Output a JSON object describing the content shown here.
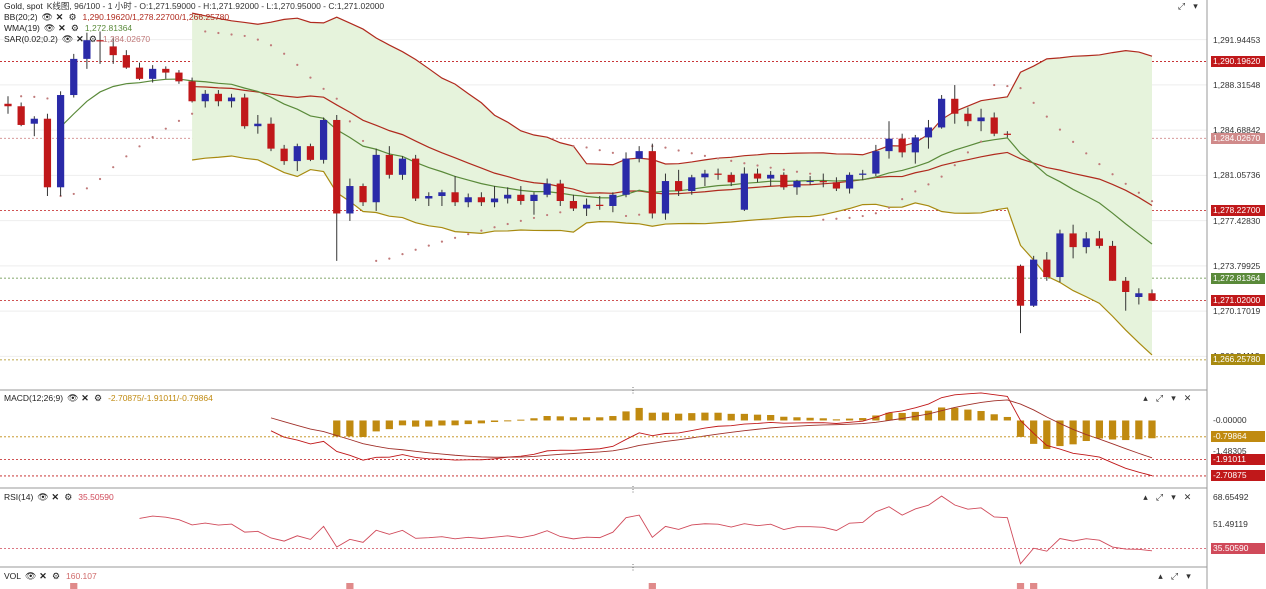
{
  "main_header": {
    "symbol_line": "Gold, spot",
    "ohlc_text": "K线图, 96/100 - 1 小时 - O:1,271.59000 - H:1,271.92000 - L:1,270.95000 - C:1,271.02000",
    "bb_label": "BB(20;2)",
    "bb_values": "1,290.19620/1,278.22700/1,266.25780",
    "wma_label": "WMA(19)",
    "wma_value": "1,272.81364",
    "sar_label": "SAR(0.02;0.2)",
    "sar_value": "1,284.02670"
  },
  "macd_header": {
    "label": "MACD(12;26;9)",
    "values": "-2.70875/-1.91011/-0.79864"
  },
  "rsi_header": {
    "label": "RSI(14)",
    "value": "35.50590"
  },
  "vol_header": {
    "label": "VOL",
    "value": "160.107"
  },
  "colors": {
    "up_candle": "#2a2aa8",
    "down_candle": "#c0181a",
    "bb_fill": "#e6f3dc",
    "bb_upper": "#b02a1e",
    "bb_lower": "#a88a10",
    "wma": "#5a8a3a",
    "sar": "#c07a7a",
    "macd_hist": "#c08a10",
    "rsi": "#d04a5a"
  },
  "chart_data": [
    {
      "type": "candlestick",
      "panel": "price",
      "y_ticks": [
        "1,291.94453",
        "1,288.31548",
        "1,284.68842",
        "1,281.05736",
        "1,277.42830",
        "1,273.79925",
        "1,270.17019",
        "1,266.54113"
      ],
      "ylim": [
        1264.0,
        1294.0
      ],
      "tags": [
        {
          "text": "1,290.19620",
          "value": 1290.1962,
          "color": "#c0181a"
        },
        {
          "text": "1,284.02670",
          "value": 1284.0267,
          "color": "#d08a8a"
        },
        {
          "text": "1,278.22700",
          "value": 1278.227,
          "color": "#c0181a"
        },
        {
          "text": "1,272.81364",
          "value": 1272.81364,
          "color": "#5a8a3a"
        },
        {
          "text": "1,271.02000",
          "value": 1271.02,
          "color": "#c0181a"
        },
        {
          "text": "1,266.25780",
          "value": 1266.2578,
          "color": "#a88a10"
        }
      ],
      "candles": [
        [
          1286.8,
          1287.4,
          1286.0,
          1286.6
        ],
        [
          1286.6,
          1286.9,
          1285.0,
          1285.1
        ],
        [
          1285.2,
          1285.8,
          1284.2,
          1285.6
        ],
        [
          1285.6,
          1286.0,
          1279.4,
          1280.1
        ],
        [
          1280.1,
          1287.8,
          1279.4,
          1287.5
        ],
        [
          1287.5,
          1290.8,
          1287.3,
          1290.4
        ],
        [
          1290.4,
          1292.5,
          1289.6,
          1291.9
        ],
        [
          1291.9,
          1292.6,
          1290.0,
          1291.8
        ],
        [
          1291.4,
          1292.1,
          1290.0,
          1290.7
        ],
        [
          1290.7,
          1291.1,
          1289.6,
          1289.7
        ],
        [
          1289.7,
          1290.1,
          1288.7,
          1288.8
        ],
        [
          1288.8,
          1289.9,
          1288.5,
          1289.6
        ],
        [
          1289.6,
          1289.8,
          1288.8,
          1289.3
        ],
        [
          1289.3,
          1289.5,
          1288.4,
          1288.6
        ],
        [
          1288.6,
          1288.9,
          1286.9,
          1287.0
        ],
        [
          1287.0,
          1287.9,
          1286.5,
          1287.6
        ],
        [
          1287.6,
          1287.9,
          1286.6,
          1287.0
        ],
        [
          1287.0,
          1287.6,
          1286.5,
          1287.3
        ],
        [
          1287.3,
          1287.6,
          1284.8,
          1285.0
        ],
        [
          1285.0,
          1285.9,
          1284.4,
          1285.2
        ],
        [
          1285.2,
          1285.7,
          1283.0,
          1283.2
        ],
        [
          1283.2,
          1283.5,
          1281.9,
          1282.2
        ],
        [
          1282.2,
          1283.6,
          1281.4,
          1283.4
        ],
        [
          1283.4,
          1283.6,
          1282.2,
          1282.3
        ],
        [
          1282.3,
          1285.7,
          1282.0,
          1285.5
        ],
        [
          1285.5,
          1285.9,
          1274.2,
          1278.0
        ],
        [
          1278.0,
          1280.8,
          1277.4,
          1280.2
        ],
        [
          1280.2,
          1280.4,
          1278.6,
          1278.9
        ],
        [
          1278.9,
          1283.2,
          1278.2,
          1282.7
        ],
        [
          1282.7,
          1283.4,
          1280.8,
          1281.1
        ],
        [
          1281.1,
          1282.6,
          1280.7,
          1282.4
        ],
        [
          1282.4,
          1282.7,
          1279.0,
          1279.2
        ],
        [
          1279.2,
          1279.7,
          1278.6,
          1279.4
        ],
        [
          1279.4,
          1279.9,
          1278.6,
          1279.7
        ],
        [
          1279.7,
          1281.0,
          1278.6,
          1278.9
        ],
        [
          1278.9,
          1279.6,
          1278.5,
          1279.3
        ],
        [
          1279.3,
          1279.7,
          1278.6,
          1278.9
        ],
        [
          1278.9,
          1280.2,
          1278.5,
          1279.2
        ],
        [
          1279.2,
          1280.1,
          1278.8,
          1279.5
        ],
        [
          1279.5,
          1280.2,
          1278.7,
          1279.0
        ],
        [
          1279.0,
          1279.7,
          1277.9,
          1279.5
        ],
        [
          1279.5,
          1280.8,
          1279.3,
          1280.4
        ],
        [
          1280.4,
          1280.7,
          1278.6,
          1279.0
        ],
        [
          1279.0,
          1279.5,
          1278.2,
          1278.4
        ],
        [
          1278.4,
          1279.2,
          1277.8,
          1278.7
        ],
        [
          1278.7,
          1279.4,
          1278.3,
          1278.6
        ],
        [
          1278.6,
          1279.7,
          1278.1,
          1279.5
        ],
        [
          1279.5,
          1282.9,
          1279.3,
          1282.4
        ],
        [
          1282.4,
          1283.4,
          1282.1,
          1283.0
        ],
        [
          1283.0,
          1283.6,
          1277.6,
          1278.0
        ],
        [
          1278.0,
          1281.2,
          1277.5,
          1280.6
        ],
        [
          1280.6,
          1281.5,
          1279.4,
          1279.8
        ],
        [
          1279.8,
          1281.1,
          1279.5,
          1280.9
        ],
        [
          1280.9,
          1281.5,
          1280.2,
          1281.2
        ],
        [
          1281.2,
          1281.6,
          1280.7,
          1281.1
        ],
        [
          1281.1,
          1281.3,
          1280.2,
          1280.5
        ],
        [
          1278.3,
          1281.7,
          1278.2,
          1281.2
        ],
        [
          1281.2,
          1281.6,
          1280.5,
          1280.8
        ],
        [
          1280.8,
          1281.4,
          1280.2,
          1281.1
        ],
        [
          1281.1,
          1281.3,
          1279.9,
          1280.1
        ],
        [
          1280.1,
          1280.7,
          1279.5,
          1280.6
        ],
        [
          1280.6,
          1281.0,
          1280.3,
          1280.6
        ],
        [
          1280.6,
          1281.2,
          1280.1,
          1280.5
        ],
        [
          1280.5,
          1280.9,
          1279.8,
          1280.0
        ],
        [
          1280.0,
          1281.3,
          1279.6,
          1281.1
        ],
        [
          1281.1,
          1281.5,
          1280.7,
          1281.2
        ],
        [
          1281.2,
          1283.5,
          1281.0,
          1283.0
        ],
        [
          1283.0,
          1285.4,
          1282.4,
          1284.0
        ],
        [
          1284.0,
          1284.4,
          1282.5,
          1282.9
        ],
        [
          1282.9,
          1284.3,
          1282.0,
          1284.1
        ],
        [
          1284.1,
          1285.5,
          1283.2,
          1284.9
        ],
        [
          1284.9,
          1287.5,
          1284.8,
          1287.2
        ],
        [
          1287.2,
          1288.3,
          1285.2,
          1286.0
        ],
        [
          1286.0,
          1286.5,
          1285.0,
          1285.4
        ],
        [
          1285.4,
          1286.4,
          1284.6,
          1285.7
        ],
        [
          1285.7,
          1286.1,
          1284.2,
          1284.4
        ],
        [
          1284.4,
          1284.6,
          1284.1,
          1284.3
        ],
        [
          1273.8,
          1273.9,
          1268.4,
          1270.6
        ],
        [
          1270.6,
          1274.6,
          1270.5,
          1274.3
        ],
        [
          1274.3,
          1274.9,
          1272.6,
          1272.9
        ],
        [
          1272.9,
          1276.7,
          1272.5,
          1276.4
        ],
        [
          1276.4,
          1277.1,
          1274.4,
          1275.3
        ],
        [
          1275.3,
          1276.5,
          1274.8,
          1276.0
        ],
        [
          1276.0,
          1276.6,
          1275.2,
          1275.4
        ],
        [
          1275.4,
          1275.8,
          1272.6,
          1272.6
        ],
        [
          1272.6,
          1272.9,
          1270.2,
          1271.7
        ],
        [
          1271.3,
          1272.0,
          1270.7,
          1271.6
        ],
        [
          1271.6,
          1271.9,
          1271.0,
          1271.0
        ]
      ]
    },
    {
      "type": "bar+line",
      "panel": "macd",
      "y_ticks": [
        "-0.00000",
        "-1.48305"
      ],
      "tags": [
        {
          "text": "-0.79864",
          "value": -0.79864,
          "color": "#c08a10"
        },
        {
          "text": "-1.91011",
          "value": -1.91011,
          "color": "#c0181a"
        },
        {
          "text": "-2.70875",
          "value": -2.70875,
          "color": "#c0181a"
        }
      ]
    },
    {
      "type": "line",
      "panel": "rsi",
      "y_ticks": [
        "68.65492",
        "51.49119"
      ],
      "tags": [
        {
          "text": "35.50590",
          "value": 35.5059,
          "color": "#d04a5a"
        }
      ]
    },
    {
      "type": "bar",
      "panel": "volume"
    }
  ]
}
